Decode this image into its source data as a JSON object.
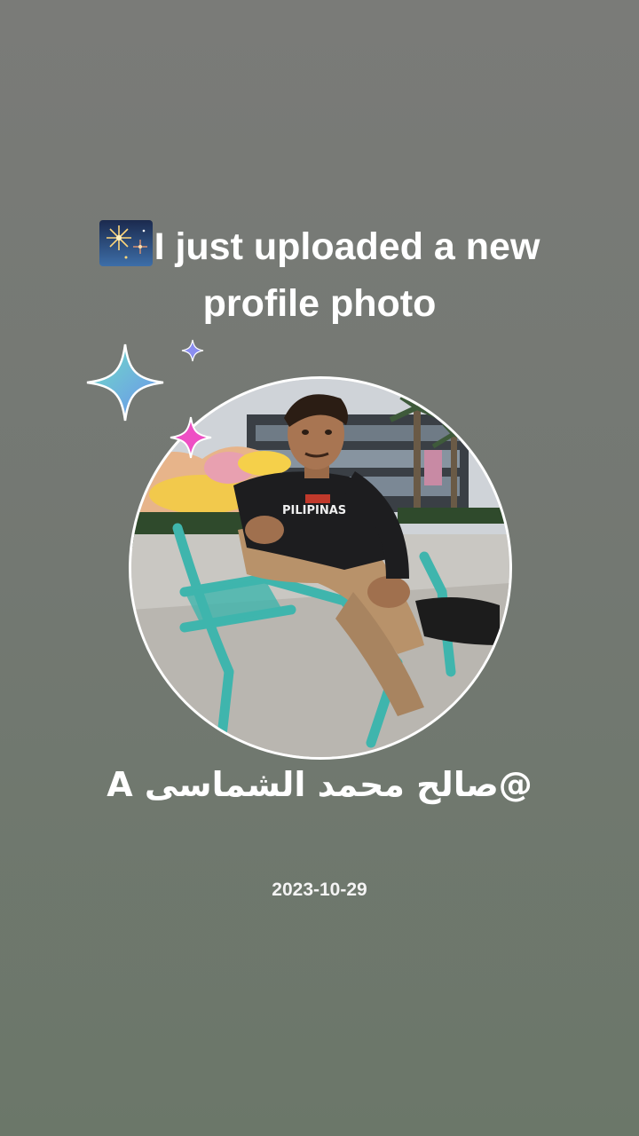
{
  "post": {
    "headline": "I just uploaded a new profile photo",
    "username": "@صالح محمد الشماسى  A",
    "date": "2023-10-29"
  },
  "photo": {
    "shirt_text": "PILIPINAS"
  },
  "icons": {
    "headline_icon": "fireworks-icon",
    "decorations": [
      "sparkle-icon-large",
      "sparkle-icon-small",
      "sparkle-icon-pink"
    ]
  },
  "colors": {
    "background_top": "#7a7b78",
    "background_bottom": "#6b7769",
    "text": "#ffffff",
    "frame_border": "#ffffff",
    "chair": "#3fb5ad"
  }
}
